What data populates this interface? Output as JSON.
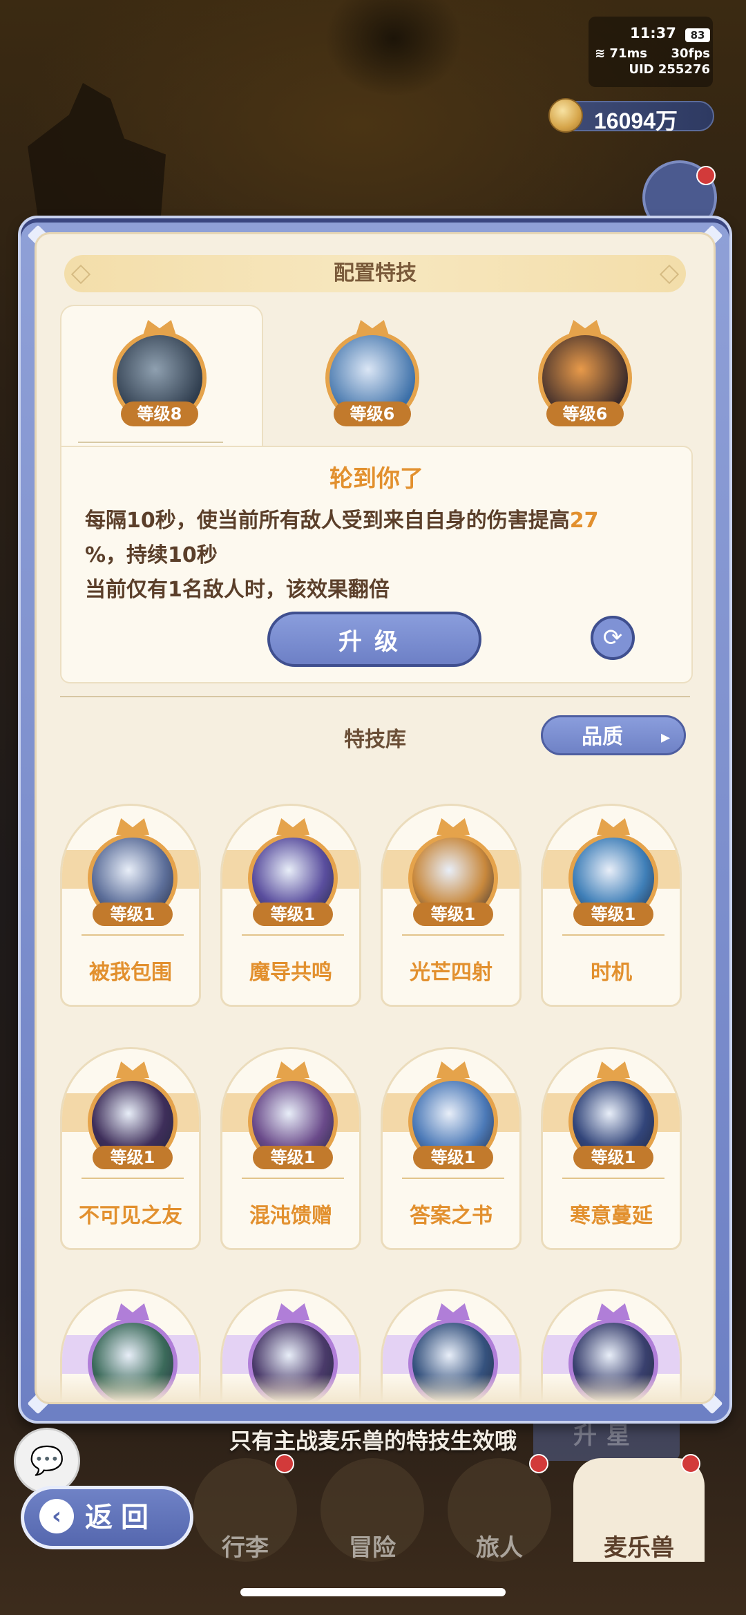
{
  "status_bar": {
    "time": "11:37",
    "battery": "83",
    "ping": "71ms",
    "fps": "30fps",
    "uid": "UID 255276"
  },
  "currency": {
    "amount": "16094万"
  },
  "panel": {
    "title": "配置特技",
    "equipped": [
      {
        "level": "等级8",
        "active": true
      },
      {
        "level": "等级6",
        "active": false
      },
      {
        "level": "等级6",
        "active": false
      }
    ],
    "selected_skill": {
      "name": "轮到你了",
      "desc_1": "每隔10秒，使当前所有敌人受到来自自身的伤害提高",
      "desc_value": "27",
      "desc_2": "%，持续10秒",
      "desc_3": "当前仅有1名敌人时，该效果翻倍"
    },
    "upgrade_label": "升级",
    "library_title": "特技库",
    "quality_label": "品质",
    "library": [
      {
        "level": "等级1",
        "name": "被我包围",
        "color": "#5d6f9a"
      },
      {
        "level": "等级1",
        "name": "魔导共鸣",
        "color": "#5a4e9e"
      },
      {
        "level": "等级1",
        "name": "光芒四射",
        "color": "#c8883c"
      },
      {
        "level": "等级1",
        "name": "时机",
        "color": "#3f7fb8"
      },
      {
        "level": "等级1",
        "name": "不可见之友",
        "color": "#3e2e5a"
      },
      {
        "level": "等级1",
        "name": "混沌馈赠",
        "color": "#6a4a8a"
      },
      {
        "level": "等级1",
        "name": "答案之书",
        "color": "#4c7ab8"
      },
      {
        "level": "等级1",
        "name": "寒意蔓延",
        "color": "#32457a"
      },
      {
        "level": "",
        "name": "",
        "color": "#3b6a5a"
      },
      {
        "level": "",
        "name": "",
        "color": "#4a3a6a"
      },
      {
        "level": "",
        "name": "",
        "color": "#35527e"
      },
      {
        "level": "",
        "name": "",
        "color": "#39406e"
      }
    ]
  },
  "hint": "只有主战麦乐兽的特技生效哦",
  "background_buttons": {
    "star_up": "升星"
  },
  "nav": [
    "行李",
    "冒险",
    "旅人",
    "麦乐兽"
  ],
  "back_label": "返回",
  "icons": [
    "coin-icon",
    "chat-icon",
    "back-arrow-icon",
    "refresh-icon",
    "chevron-right-icon"
  ]
}
